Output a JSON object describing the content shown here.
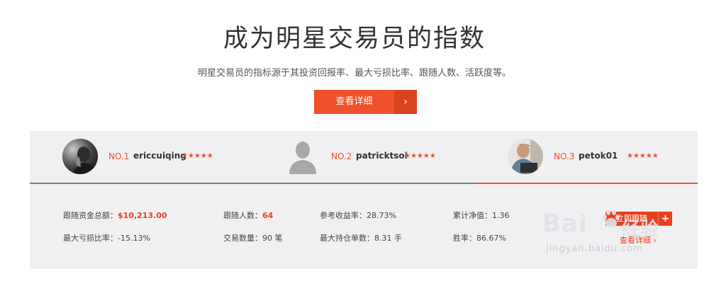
{
  "hero": {
    "title": "成为明星交易员的指数",
    "subtitle": "明星交易员的指标源于其投资回报率、最大亏损比率、跟随人数、活跃度等。",
    "detail_button": "查看详细",
    "detail_arrow": "›"
  },
  "traders": [
    {
      "rank": "NO.1",
      "name": "ericcuiqing",
      "stars": "★★★★★",
      "avatar": "avatar-photo-icon"
    },
    {
      "rank": "NO.2",
      "name": "patricktsoi",
      "stars": "★★★★★",
      "avatar": "default-user-silhouette-icon"
    },
    {
      "rank": "NO.3",
      "name": "petok01",
      "stars": "★★★★★",
      "avatar": "avatar-photo-icon"
    }
  ],
  "active_tab": 2,
  "stats": {
    "follow_funds_label": "跟随资金总额：",
    "follow_funds_value": "$10,213.00",
    "max_loss_label": "最大亏损比率：",
    "max_loss_value": "-15.13%",
    "followers_label": "跟随人数：",
    "followers_value": "64",
    "trades_label": "交易数量：",
    "trades_value": "90 笔",
    "ref_return_label": "参考收益率：",
    "ref_return_value": "28.73%",
    "max_position_label": "最大持仓单数：",
    "max_position_value": "8.31 手",
    "nav_label": "累计净值：",
    "nav_value": "1.36",
    "win_rate_label": "胜率：",
    "win_rate_value": "86.67%"
  },
  "actions": {
    "follow_button": "立即跟随",
    "follow_plus": "+",
    "view_link": "查看详细 ›"
  },
  "watermark": {
    "brand_left": "Bai",
    "brand_right": "经验",
    "url": "jingyan.baidu.com"
  },
  "colors": {
    "accent": "#f0502a",
    "panel_bg": "#f0f0f2"
  }
}
